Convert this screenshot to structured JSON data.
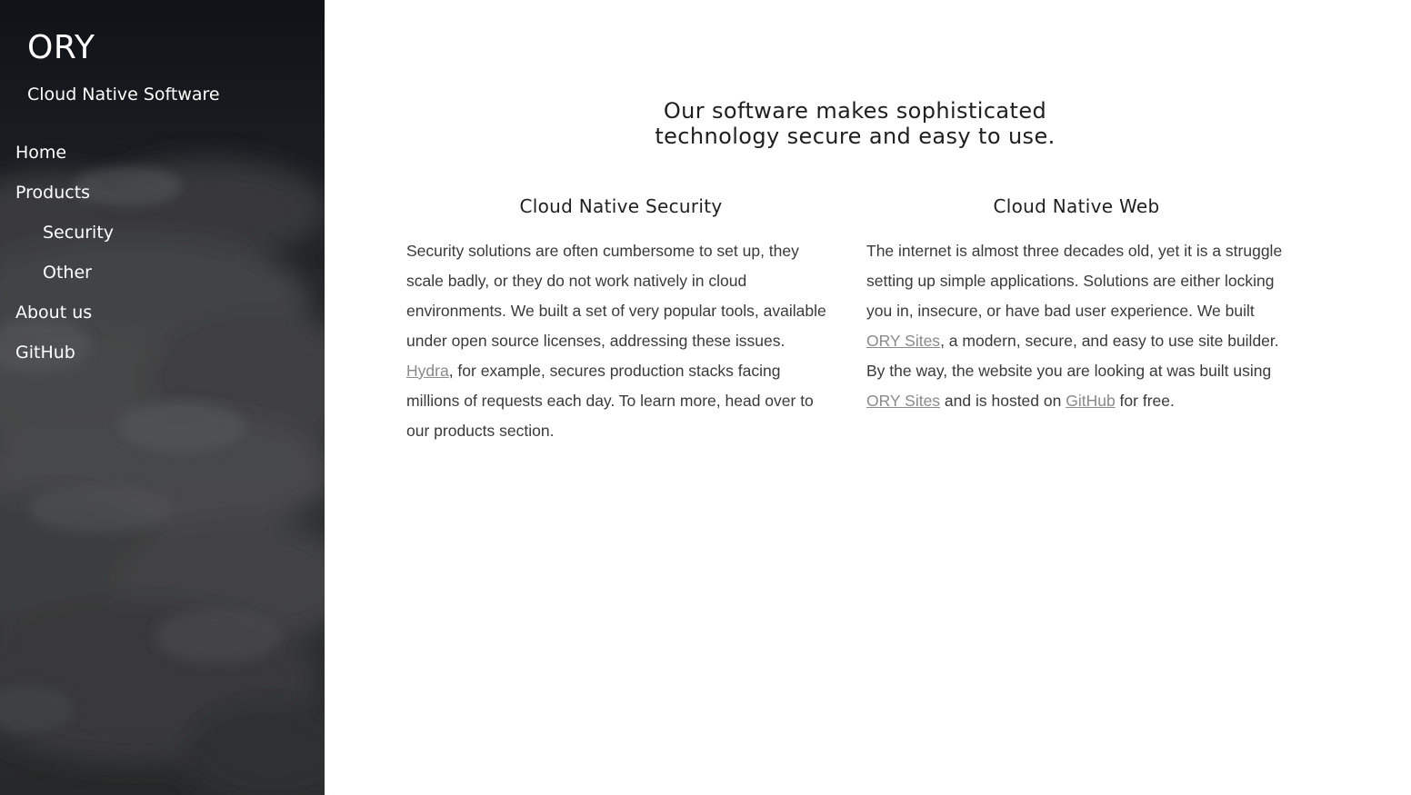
{
  "sidebar": {
    "brand_title": "ORY",
    "brand_subtitle": "Cloud Native Software",
    "nav": {
      "home": "Home",
      "products": "Products",
      "security": "Security",
      "other": "Other",
      "about": "About us",
      "github": "GitHub"
    }
  },
  "main": {
    "tagline_line1": "Our software makes sophisticated",
    "tagline_line2": "technology secure and easy to use.",
    "security": {
      "heading": "Cloud Native Security",
      "text_before_link": "Security solutions are often cumbersome to set up, they scale badly, or they do not work natively in cloud environments. We built a set of very popular tools, available under open source licenses, addressing these issues. ",
      "link": "Hydra",
      "text_after_link": ", for example, secures production stacks facing millions of requests each day. To learn more, head over to our products section."
    },
    "web": {
      "heading": "Cloud Native Web",
      "text_1": "The internet is almost three decades old, yet it is a struggle setting up simple applications. Solutions are either locking you in, insecure, or have bad user experience. We built ",
      "link_1": "ORY Sites",
      "text_2": ", a modern, secure, and easy to use site builder. By the way, the website you are looking at was built using ",
      "link_2": "ORY Sites",
      "text_3": " and is hosted on ",
      "link_3": "GitHub",
      "text_4": " for free."
    }
  },
  "colors": {
    "sidebar_dark": "#0f1216",
    "sidebar_cloud": "#2e2f30",
    "link": "#8a8a8a",
    "text": "#3a3a3a",
    "heading": "#1f1f1f"
  }
}
